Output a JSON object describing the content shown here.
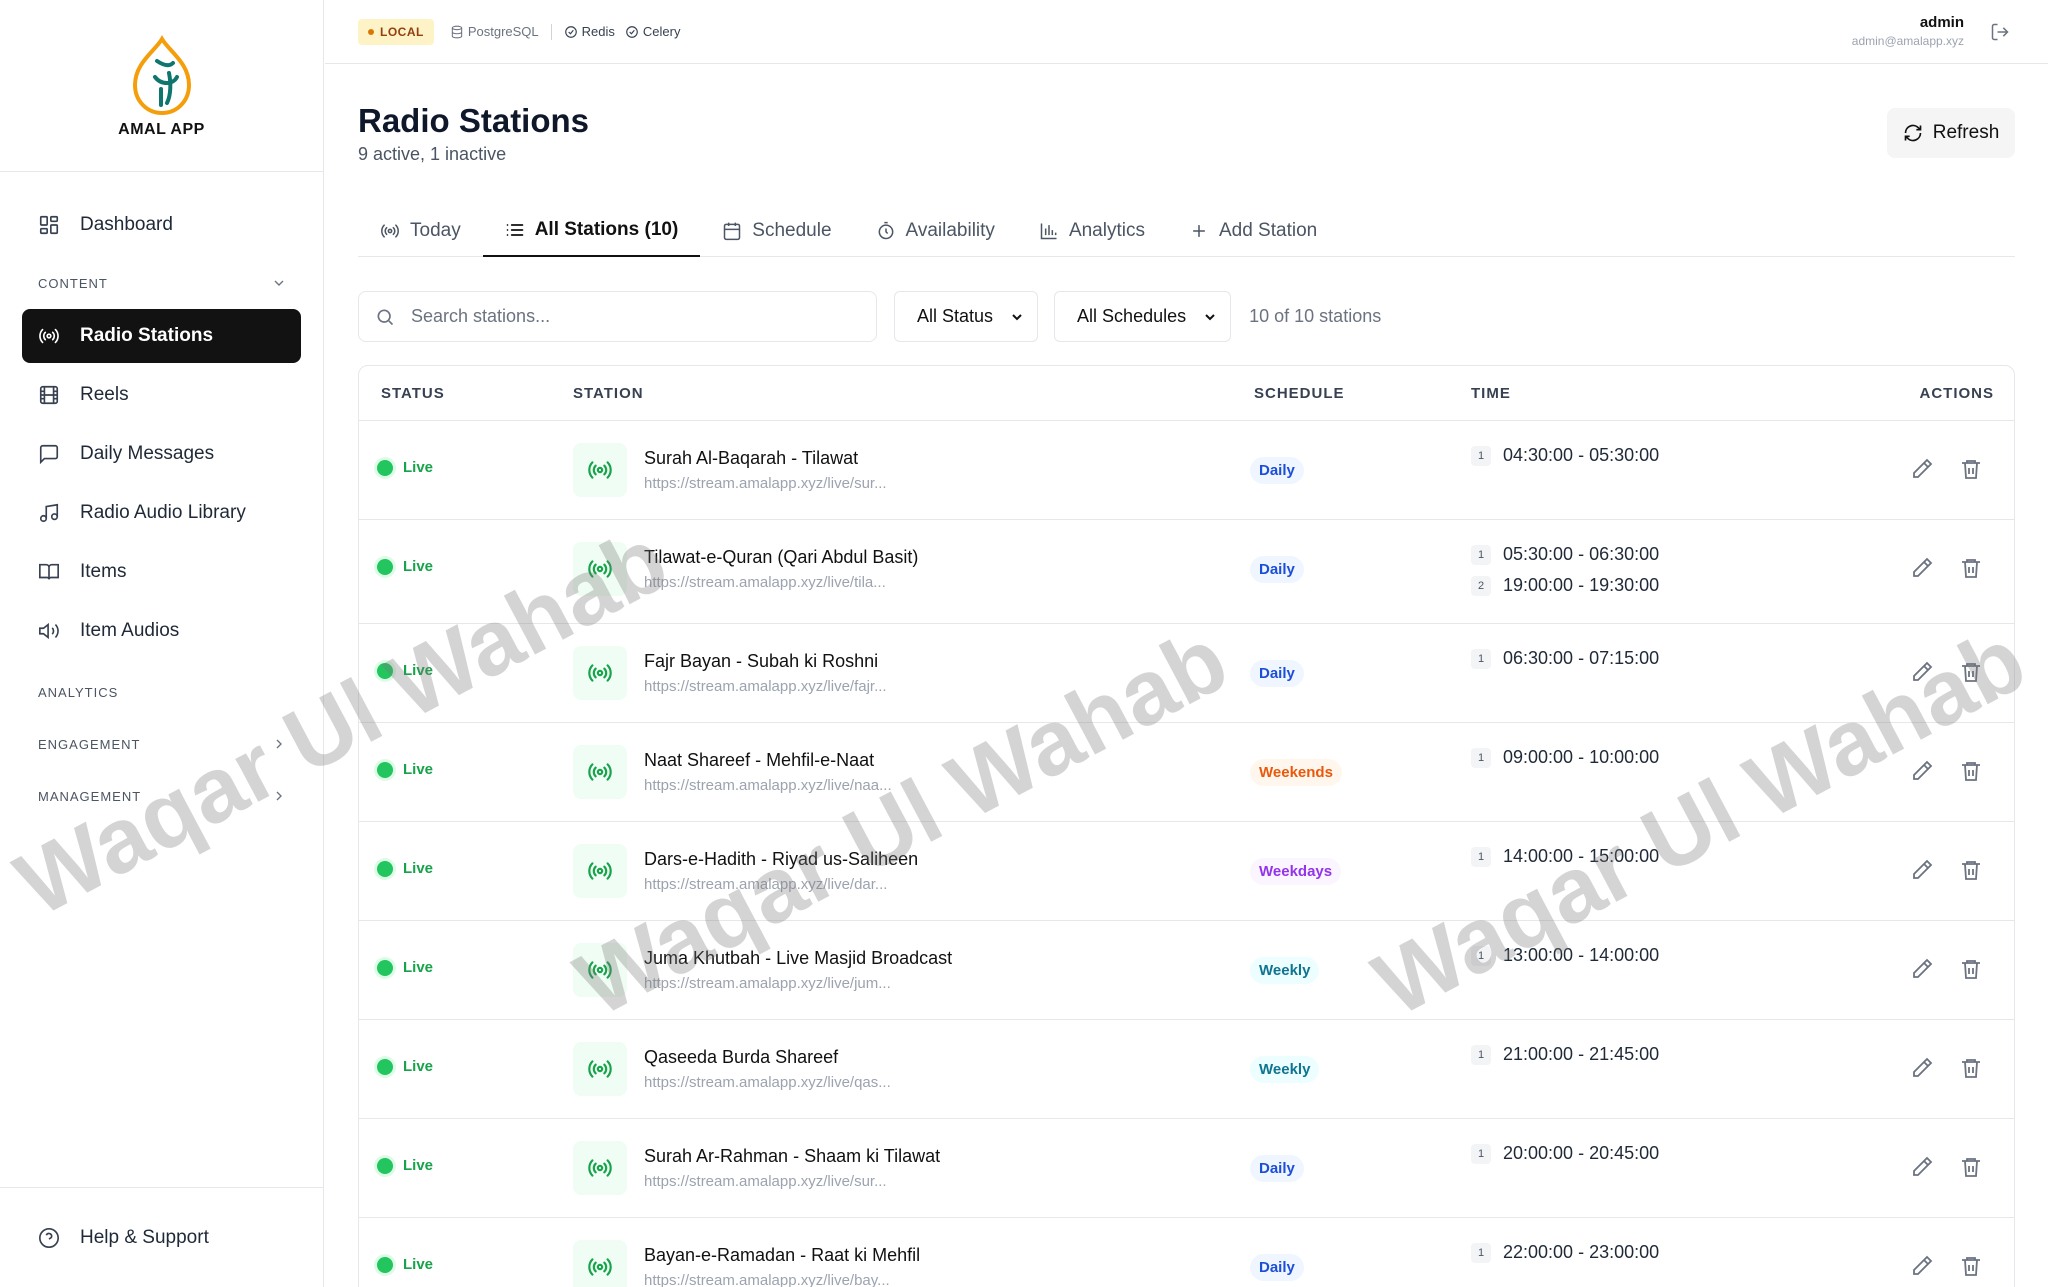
{
  "app": {
    "brand_name": "AMAL APP",
    "env": "LOCAL",
    "services": [
      "PostgreSQL",
      "Redis",
      "Celery"
    ]
  },
  "user": {
    "name": "admin",
    "email": "admin@amalapp.xyz"
  },
  "sidebar": {
    "dashboard": "Dashboard",
    "content_section": "CONTENT",
    "content_items": [
      "Radio Stations",
      "Reels",
      "Daily Messages",
      "Radio Audio Library",
      "Items",
      "Item Audios"
    ],
    "analytics_section": "ANALYTICS",
    "engagement_section": "ENGAGEMENT",
    "management_section": "MANAGEMENT",
    "help": "Help & Support"
  },
  "page": {
    "title": "Radio Stations",
    "subtitle": "9 active, 1 inactive",
    "refresh_label": "Refresh"
  },
  "tabs": [
    "Today",
    "All Stations (10)",
    "Schedule",
    "Availability",
    "Analytics",
    "Add Station"
  ],
  "filters": {
    "search_placeholder": "Search stations...",
    "status": "All Status",
    "schedule": "All Schedules",
    "count": "10 of 10 stations"
  },
  "table": {
    "headers": [
      "STATUS",
      "STATION",
      "SCHEDULE",
      "TIME",
      "ACTIONS"
    ],
    "rows": [
      {
        "status": "Live",
        "name": "Surah Al-Baqarah - Tilawat",
        "url": "https://stream.amalapp.xyz/live/sur...",
        "schedule": "Daily",
        "times": [
          "04:30:00 - 05:30:00"
        ]
      },
      {
        "status": "Live",
        "name": "Tilawat-e-Quran (Qari Abdul Basit)",
        "url": "https://stream.amalapp.xyz/live/tila...",
        "schedule": "Daily",
        "times": [
          "05:30:00 - 06:30:00",
          "19:00:00 - 19:30:00"
        ]
      },
      {
        "status": "Live",
        "name": "Fajr Bayan - Subah ki Roshni",
        "url": "https://stream.amalapp.xyz/live/fajr...",
        "schedule": "Daily",
        "times": [
          "06:30:00 - 07:15:00"
        ]
      },
      {
        "status": "Live",
        "name": "Naat Shareef - Mehfil-e-Naat",
        "url": "https://stream.amalapp.xyz/live/naa...",
        "schedule": "Weekends",
        "times": [
          "09:00:00 - 10:00:00"
        ]
      },
      {
        "status": "Live",
        "name": "Dars-e-Hadith - Riyad us-Saliheen",
        "url": "https://stream.amalapp.xyz/live/dar...",
        "schedule": "Weekdays",
        "times": [
          "14:00:00 - 15:00:00"
        ]
      },
      {
        "status": "Live",
        "name": "Juma Khutbah - Live Masjid Broadcast",
        "url": "https://stream.amalapp.xyz/live/jum...",
        "schedule": "Weekly",
        "times": [
          "13:00:00 - 14:00:00"
        ]
      },
      {
        "status": "Live",
        "name": "Qaseeda Burda Shareef",
        "url": "https://stream.amalapp.xyz/live/qas...",
        "schedule": "Weekly",
        "times": [
          "21:00:00 - 21:45:00"
        ]
      },
      {
        "status": "Live",
        "name": "Surah Ar-Rahman - Shaam ki Tilawat",
        "url": "https://stream.amalapp.xyz/live/sur...",
        "schedule": "Daily",
        "times": [
          "20:00:00 - 20:45:00"
        ]
      },
      {
        "status": "Live",
        "name": "Bayan-e-Ramadan - Raat ki Mehfil",
        "url": "https://stream.amalapp.xyz/live/bay...",
        "schedule": "Daily",
        "times": [
          "22:00:00 - 23:00:00"
        ]
      }
    ]
  },
  "watermark": "Waqar Ul Wahab",
  "colors": {
    "accent": "#121212",
    "live": "#22c55e",
    "brand_orange": "#f59e0b",
    "brand_teal": "#0f766e"
  }
}
